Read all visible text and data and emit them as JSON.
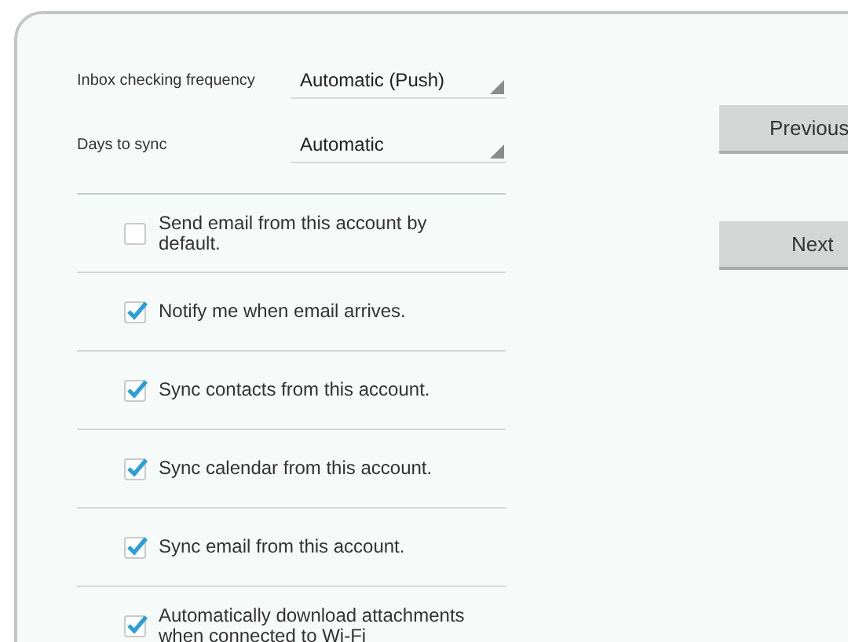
{
  "settings": [
    {
      "label": "Inbox checking frequency",
      "value": "Automatic (Push)"
    },
    {
      "label": "Days to sync",
      "value": "Automatic"
    }
  ],
  "options": [
    {
      "label": "Send email from this account by default.",
      "checked": false
    },
    {
      "label": "Notify me when email arrives.",
      "checked": true
    },
    {
      "label": "Sync contacts from this account.",
      "checked": true
    },
    {
      "label": "Sync calendar from this account.",
      "checked": true
    },
    {
      "label": "Sync email from this account.",
      "checked": true
    },
    {
      "label": "Automatically download attachments when connected to Wi-Fi",
      "checked": true
    }
  ],
  "buttons": [
    "Previous",
    "Next"
  ]
}
